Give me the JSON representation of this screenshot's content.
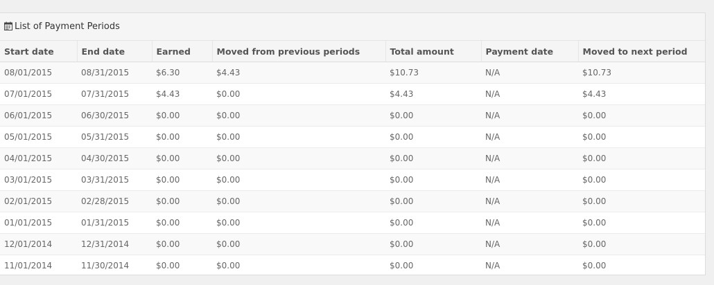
{
  "panel": {
    "title": "List of Payment Periods",
    "icon": "calendar-icon"
  },
  "table": {
    "columns": [
      "Start date",
      "End date",
      "Earned",
      "Moved from previous periods",
      "Total amount",
      "Payment date",
      "Moved to next period"
    ],
    "rows": [
      [
        "08/01/2015",
        "08/31/2015",
        "$6.30",
        "$4.43",
        "$10.73",
        "N/A",
        "$10.73"
      ],
      [
        "07/01/2015",
        "07/31/2015",
        "$4.43",
        "$0.00",
        "$4.43",
        "N/A",
        "$4.43"
      ],
      [
        "06/01/2015",
        "06/30/2015",
        "$0.00",
        "$0.00",
        "$0.00",
        "N/A",
        "$0.00"
      ],
      [
        "05/01/2015",
        "05/31/2015",
        "$0.00",
        "$0.00",
        "$0.00",
        "N/A",
        "$0.00"
      ],
      [
        "04/01/2015",
        "04/30/2015",
        "$0.00",
        "$0.00",
        "$0.00",
        "N/A",
        "$0.00"
      ],
      [
        "03/01/2015",
        "03/31/2015",
        "$0.00",
        "$0.00",
        "$0.00",
        "N/A",
        "$0.00"
      ],
      [
        "02/01/2015",
        "02/28/2015",
        "$0.00",
        "$0.00",
        "$0.00",
        "N/A",
        "$0.00"
      ],
      [
        "01/01/2015",
        "01/31/2015",
        "$0.00",
        "$0.00",
        "$0.00",
        "N/A",
        "$0.00"
      ],
      [
        "12/01/2014",
        "12/31/2014",
        "$0.00",
        "$0.00",
        "$0.00",
        "N/A",
        "$0.00"
      ],
      [
        "11/01/2014",
        "11/30/2014",
        "$0.00",
        "$0.00",
        "$0.00",
        "N/A",
        "$0.00"
      ]
    ]
  }
}
